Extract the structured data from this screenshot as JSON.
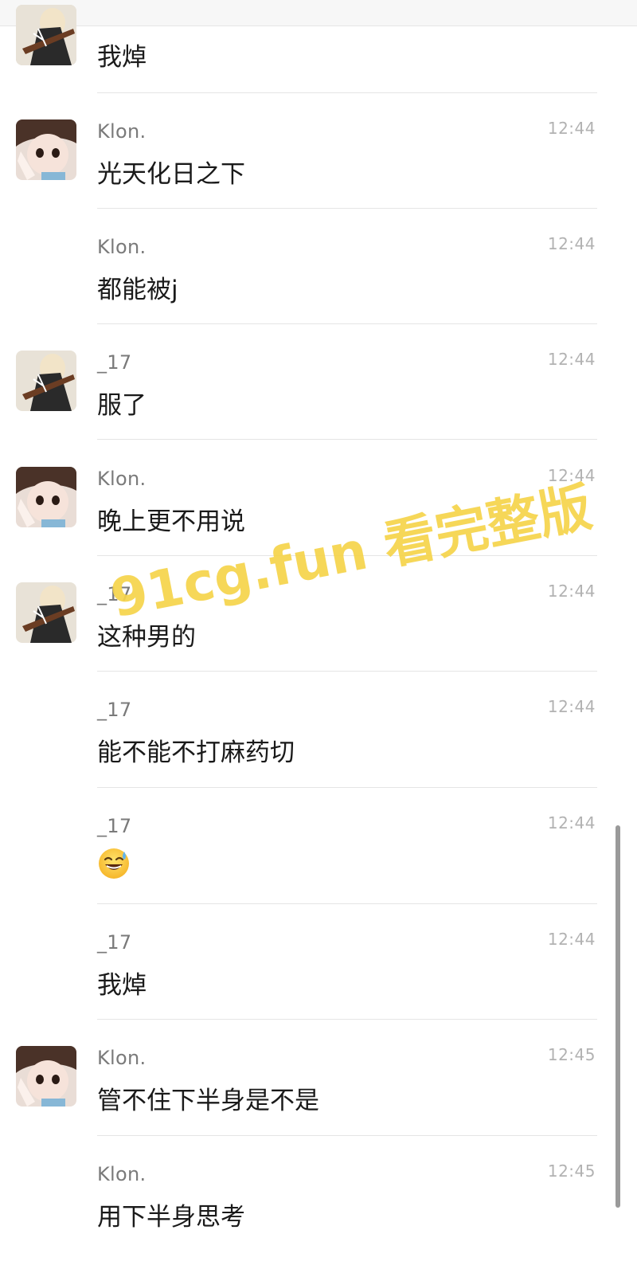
{
  "messages": [
    {
      "sender": "",
      "time": "",
      "text": "我焯"
    },
    {
      "sender": "Klon.",
      "time": "12:44",
      "text": "光天化日之下"
    },
    {
      "sender": "Klon.",
      "time": "12:44",
      "text": "都能被j"
    },
    {
      "sender": "_17",
      "time": "12:44",
      "text": "服了"
    },
    {
      "sender": "Klon.",
      "time": "12:44",
      "text": "晚上更不用说"
    },
    {
      "sender": "_17",
      "time": "12:44",
      "text": "这种男的"
    },
    {
      "sender": "_17",
      "time": "12:44",
      "text": "能不能不打麻药切"
    },
    {
      "sender": "_17",
      "time": "12:44",
      "text": ""
    },
    {
      "sender": "_17",
      "time": "12:44",
      "text": "我焯"
    },
    {
      "sender": "Klon.",
      "time": "12:45",
      "text": "管不住下半身是不是"
    },
    {
      "sender": "Klon.",
      "time": "12:45",
      "text": "用下半身思考"
    }
  ],
  "emoji": "grinning-face-with-sweat-icon",
  "watermark": "91cg.fun 看完整版",
  "colors": {
    "name": "#7a7a7a",
    "time": "#b2b2b2",
    "text": "#1a1a1a",
    "watermark": "#f6d44a"
  }
}
